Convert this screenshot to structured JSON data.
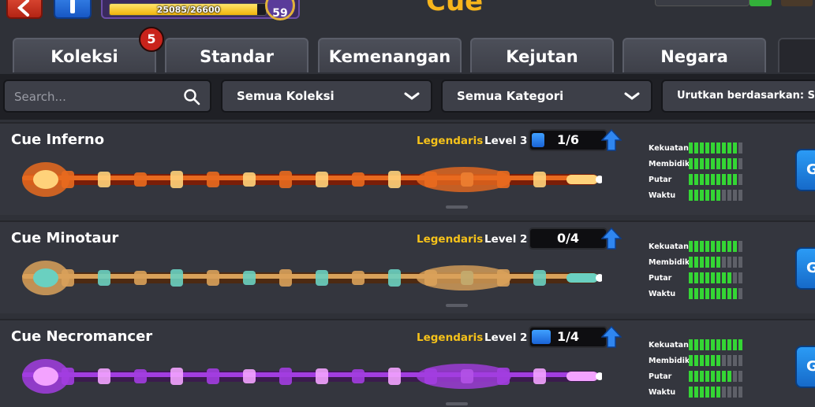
{
  "topbar": {
    "xp_text": "25085/26600",
    "xp_progress": 0.943,
    "player_level": "59",
    "page_title": "Cue"
  },
  "tabs": [
    {
      "label": "Koleksi",
      "badge": "5"
    },
    {
      "label": "Standar"
    },
    {
      "label": "Kemenangan"
    },
    {
      "label": "Kejutan"
    },
    {
      "label": "Negara"
    }
  ],
  "filters": {
    "search_placeholder": "Search...",
    "collection": "Semua Koleksi",
    "category": "Semua Kategori",
    "sort": "Urutkan berdasarkan: Stat"
  },
  "stat_labels": [
    "Kekuatan",
    "Membidik",
    "Putar",
    "Waktu"
  ],
  "cues": [
    {
      "name": "Cue Inferno",
      "rarity": "Legendaris",
      "level": "Level 3",
      "progress_text": "1/6",
      "progress": 0.1667,
      "upgrade_available": true,
      "stats": [
        9,
        9,
        9,
        6
      ],
      "use_label": "G",
      "colors": [
        "#e86a1f",
        "#ffd27a",
        "#7a1e08"
      ]
    },
    {
      "name": "Cue Minotaur",
      "rarity": "Legendaris",
      "level": "Level 2",
      "progress_text": "0/4",
      "progress": 0,
      "upgrade_available": true,
      "stats": [
        9,
        6,
        8,
        9
      ],
      "use_label": "G",
      "colors": [
        "#d9a15a",
        "#6ad0c0",
        "#4d2a12"
      ]
    },
    {
      "name": "Cue Necromancer",
      "rarity": "Legendaris",
      "level": "Level 2",
      "progress_text": "1/4",
      "progress": 0.25,
      "upgrade_available": true,
      "stats": [
        10,
        6,
        8,
        6
      ],
      "use_label": "G",
      "colors": [
        "#a23de0",
        "#f3a3ff",
        "#3b1b4e"
      ]
    }
  ],
  "stat_max": 10
}
